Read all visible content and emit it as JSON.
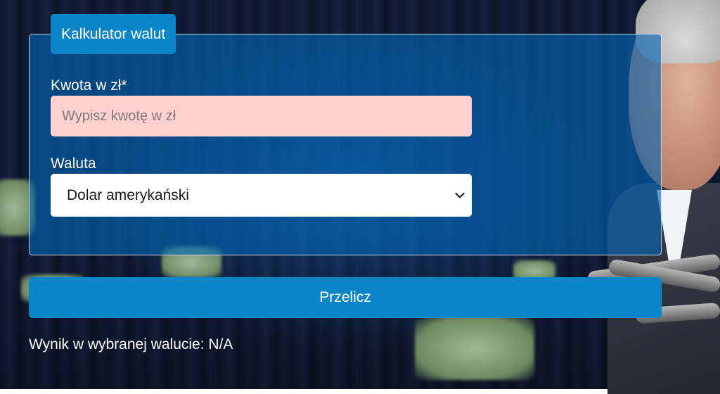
{
  "calculator": {
    "legend": "Kalkulator walut",
    "amount_label": "Kwota w zł*",
    "amount_placeholder": "Wypisz kwotę w zł",
    "amount_value": "",
    "currency_label": "Waluta",
    "currency_selected": "Dolar amerykański",
    "submit_label": "Przelicz"
  },
  "result": {
    "label": "Wynik w wybranej walucie:",
    "value": "N/A"
  },
  "colors": {
    "panel": "#0466b4",
    "accent": "#0a86c8",
    "input_invalid": "#ffd0cd"
  },
  "icons": {
    "select_arrow": "chevron-down-icon"
  }
}
